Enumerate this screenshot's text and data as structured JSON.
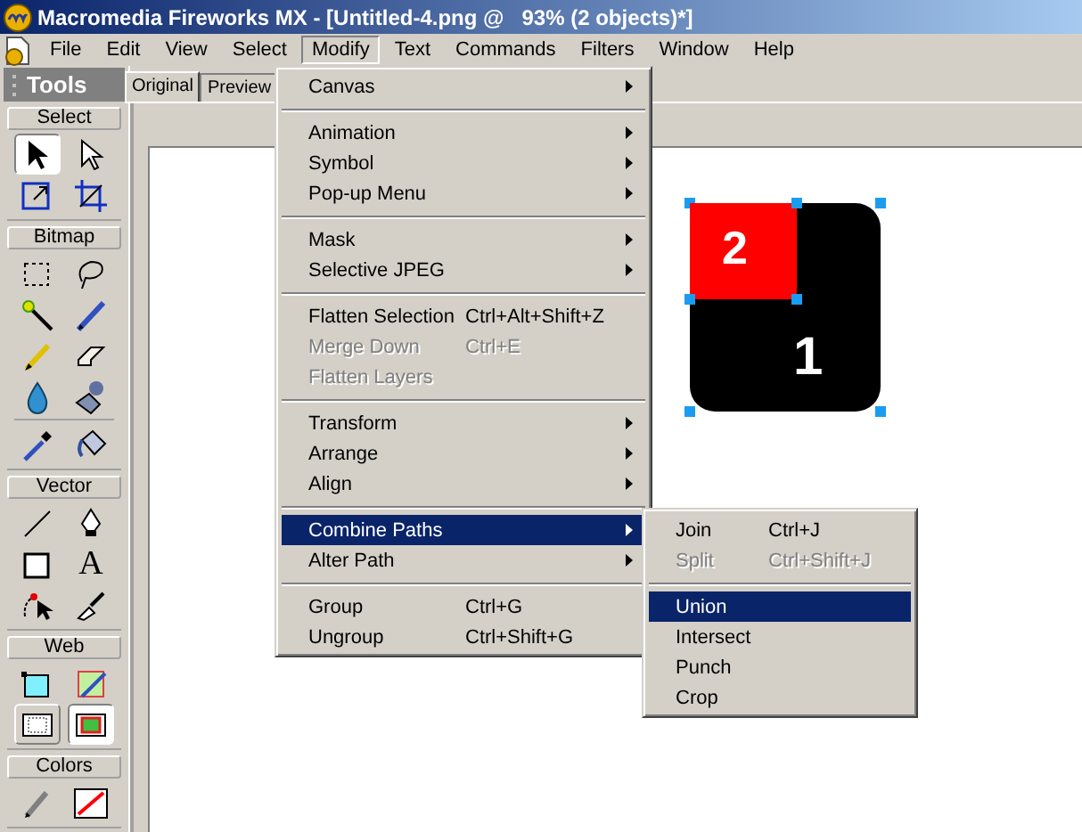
{
  "window": {
    "title": "Macromedia Fireworks MX - [Untitled-4.png @   93% (2 objects)*]"
  },
  "menu_bar": [
    {
      "label": "File",
      "selected": false
    },
    {
      "label": "Edit",
      "selected": false
    },
    {
      "label": "View",
      "selected": false
    },
    {
      "label": "Select",
      "selected": false
    },
    {
      "label": "Modify",
      "selected": true
    },
    {
      "label": "Text",
      "selected": false
    },
    {
      "label": "Commands",
      "selected": false
    },
    {
      "label": "Filters",
      "selected": false
    },
    {
      "label": "Window",
      "selected": false
    },
    {
      "label": "Help",
      "selected": false
    }
  ],
  "tools_panel": {
    "title": "Tools",
    "sections": [
      {
        "title": "Select",
        "tools": [
          {
            "selected": true
          },
          {
            "selected": false
          },
          {
            "selected": false
          },
          {
            "selected": false
          }
        ]
      },
      {
        "title": "Bitmap",
        "tools": [
          {
            "selected": false
          },
          {
            "selected": false
          },
          {
            "selected": false
          },
          {
            "selected": false
          },
          {
            "selected": false
          },
          {
            "selected": false
          },
          {
            "selected": false
          },
          {
            "selected": false
          },
          {
            "selected": false
          },
          {
            "selected": false
          }
        ]
      },
      {
        "title": "Vector",
        "tools": [
          {
            "selected": false
          },
          {
            "selected": false
          },
          {
            "selected": false
          },
          {
            "selected": false,
            "glyph": "A"
          },
          {
            "selected": false
          },
          {
            "selected": false
          }
        ]
      },
      {
        "title": "Web",
        "tools": [
          {
            "selected": false
          },
          {
            "selected": false
          },
          {
            "selected": false
          },
          {
            "selected": true
          }
        ]
      },
      {
        "title": "Colors",
        "tools": [
          {
            "selected": false
          },
          {
            "selected": false
          }
        ]
      }
    ]
  },
  "document_tabs": [
    {
      "label": "Original",
      "selected": true
    },
    {
      "label": "Preview",
      "selected": false
    }
  ],
  "canvas": {
    "objects": [
      {
        "label": "1",
        "color": "#000000",
        "selected": true
      },
      {
        "label": "2",
        "color": "#ff0000",
        "selected": true
      }
    ]
  },
  "modify_menu": {
    "items": [
      {
        "kind": "item",
        "label": "Canvas",
        "has_submenu": true,
        "disabled": false,
        "selected": false
      },
      {
        "kind": "separator"
      },
      {
        "kind": "item",
        "label": "Animation",
        "has_submenu": true,
        "disabled": false,
        "selected": false
      },
      {
        "kind": "item",
        "label": "Symbol",
        "has_submenu": true,
        "disabled": false,
        "selected": false
      },
      {
        "kind": "item",
        "label": "Pop-up Menu",
        "has_submenu": true,
        "disabled": false,
        "selected": false
      },
      {
        "kind": "separator"
      },
      {
        "kind": "item",
        "label": "Mask",
        "has_submenu": true,
        "disabled": false,
        "selected": false
      },
      {
        "kind": "item",
        "label": "Selective JPEG",
        "has_submenu": true,
        "disabled": false,
        "selected": false
      },
      {
        "kind": "separator"
      },
      {
        "kind": "item",
        "label": "Flatten Selection",
        "shortcut": "Ctrl+Alt+Shift+Z",
        "has_submenu": false,
        "disabled": false,
        "selected": false
      },
      {
        "kind": "item",
        "label": "Merge Down",
        "shortcut": "Ctrl+E",
        "has_submenu": false,
        "disabled": true,
        "selected": false
      },
      {
        "kind": "item",
        "label": "Flatten Layers",
        "has_submenu": false,
        "disabled": true,
        "selected": false
      },
      {
        "kind": "separator"
      },
      {
        "kind": "item",
        "label": "Transform",
        "has_submenu": true,
        "disabled": false,
        "selected": false
      },
      {
        "kind": "item",
        "label": "Arrange",
        "has_submenu": true,
        "disabled": false,
        "selected": false
      },
      {
        "kind": "item",
        "label": "Align",
        "has_submenu": true,
        "disabled": false,
        "selected": false
      },
      {
        "kind": "separator"
      },
      {
        "kind": "item",
        "label": "Combine Paths",
        "has_submenu": true,
        "disabled": false,
        "selected": true
      },
      {
        "kind": "item",
        "label": "Alter Path",
        "has_submenu": true,
        "disabled": false,
        "selected": false
      },
      {
        "kind": "separator"
      },
      {
        "kind": "item",
        "label": "Group",
        "shortcut": "Ctrl+G",
        "has_submenu": false,
        "disabled": false,
        "selected": false
      },
      {
        "kind": "item",
        "label": "Ungroup",
        "shortcut": "Ctrl+Shift+G",
        "has_submenu": false,
        "disabled": false,
        "selected": false
      }
    ]
  },
  "combine_paths_submenu": {
    "items": [
      {
        "kind": "item",
        "label": "Join",
        "shortcut": "Ctrl+J",
        "disabled": false,
        "selected": false
      },
      {
        "kind": "item",
        "label": "Split",
        "shortcut": "Ctrl+Shift+J",
        "disabled": true,
        "selected": false
      },
      {
        "kind": "separator"
      },
      {
        "kind": "item",
        "label": "Union",
        "disabled": false,
        "selected": true
      },
      {
        "kind": "item",
        "label": "Intersect",
        "disabled": false,
        "selected": false
      },
      {
        "kind": "item",
        "label": "Punch",
        "disabled": false,
        "selected": false
      },
      {
        "kind": "item",
        "label": "Crop",
        "disabled": false,
        "selected": false
      }
    ]
  }
}
